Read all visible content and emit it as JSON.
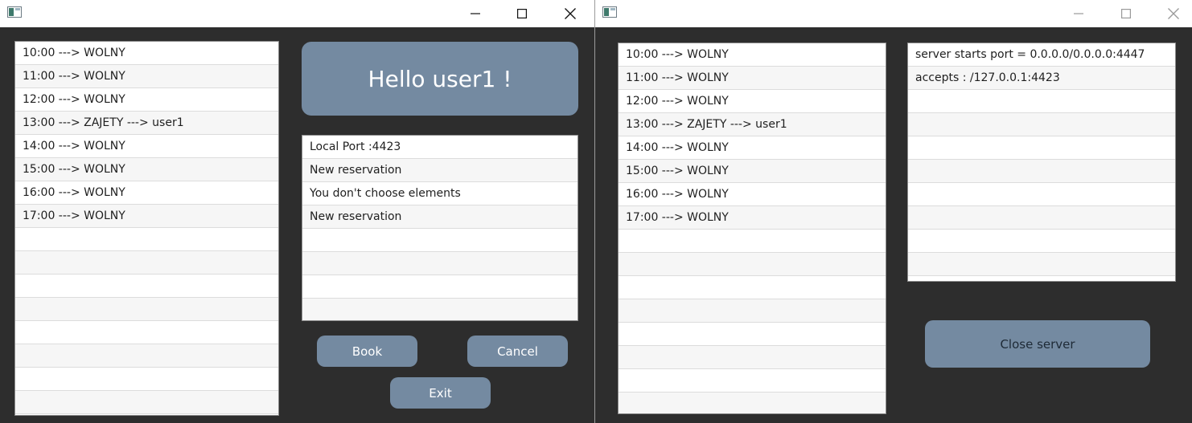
{
  "client": {
    "hours": [
      "10:00 ---> WOLNY",
      "11:00 ---> WOLNY",
      "12:00 ---> WOLNY",
      "13:00 ---> ZAJETY ---> user1",
      "14:00 ---> WOLNY",
      "15:00 ---> WOLNY",
      "16:00 ---> WOLNY",
      "17:00 ---> WOLNY",
      "",
      "",
      "",
      "",
      "",
      "",
      "",
      ""
    ],
    "greeting": "Hello user1 !",
    "log": [
      "Local Port :4423",
      "New reservation",
      "You don't choose elements",
      "New reservation",
      "",
      "",
      "",
      ""
    ],
    "buttons": {
      "book": "Book",
      "cancel": "Cancel",
      "exit": "Exit"
    }
  },
  "server": {
    "hours": [
      "10:00 ---> WOLNY",
      "11:00 ---> WOLNY",
      "12:00 ---> WOLNY",
      "13:00 ---> ZAJETY ---> user1",
      "14:00 ---> WOLNY",
      "15:00 ---> WOLNY",
      "16:00 ---> WOLNY",
      "17:00 ---> WOLNY",
      "",
      "",
      "",
      "",
      "",
      "",
      "",
      ""
    ],
    "log": [
      "server starts port = 0.0.0.0/0.0.0.0:4447",
      "accepts : /127.0.0.1:4423",
      "",
      "",
      "",
      "",
      "",
      "",
      "",
      ""
    ],
    "buttons": {
      "close_server": "Close server"
    }
  },
  "icons": {
    "app": "app-icon",
    "minimize": "minimize-icon",
    "maximize": "maximize-icon",
    "close": "close-icon"
  },
  "colors": {
    "window_background": "#2d2d2d",
    "accent": "#748aa1",
    "titlebar": "#ffffff"
  }
}
